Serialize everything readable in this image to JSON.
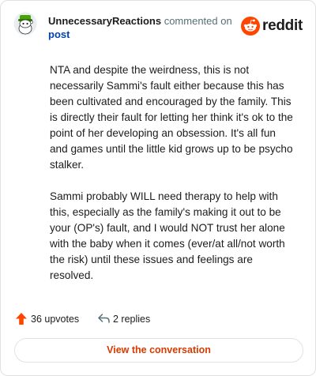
{
  "comment": {
    "author": "UnnecessaryReactions",
    "action_text": "commented on",
    "post_link": "post",
    "paragraphs": [
      "NTA and despite the weirdness, this is not necessarily Sammi's fault either because this has been cultivated and encouraged by the family. This is directly their fault for letting her think it's ok to the point of her developing an obsession. It's all fun and games until the little kid grows up to be psycho stalker.",
      "Sammi probably WILL need therapy to help with this, especially as the family's making it out to be your (OP's) fault, and I would NOT trust her alone with the baby when it comes (ever/at all/not worth the risk) until these issues and feelings are resolved."
    ],
    "upvotes_label": "36 upvotes",
    "replies_label": "2 replies",
    "view_button": "View the conversation"
  },
  "brand": {
    "name": "reddit",
    "icon": "reddit-snoo-icon",
    "color": "#ff4500"
  },
  "icons": {
    "upvote": "upvote-arrow-icon",
    "reply": "reply-arrow-icon"
  },
  "colors": {
    "upvote": "#ff4500",
    "link": "#0045ac",
    "button_text": "#d93a00",
    "muted": "#576f76"
  }
}
